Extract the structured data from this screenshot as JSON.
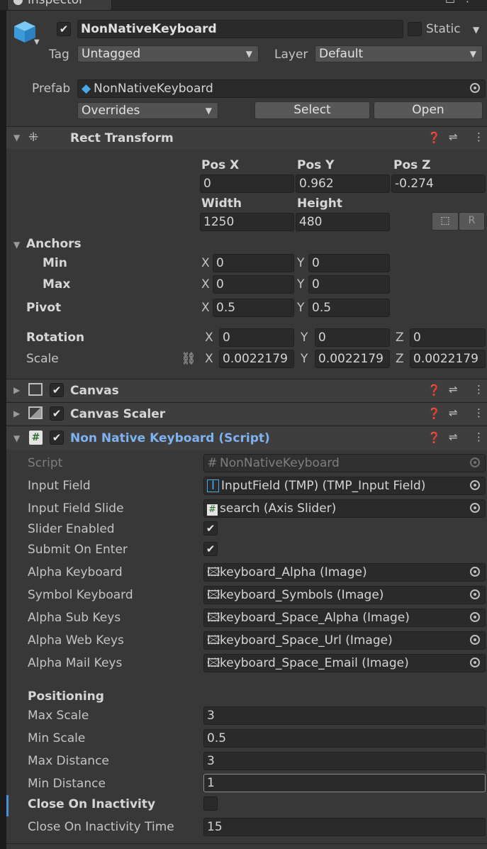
{
  "window": {
    "tab_title": "Inspector"
  },
  "object": {
    "active": true,
    "name": "NonNativeKeyboard",
    "static_label": "Static",
    "tag_label": "Tag",
    "tag_value": "Untagged",
    "layer_label": "Layer",
    "layer_value": "Default",
    "prefab_label": "Prefab",
    "prefab_value": "NonNativeKeyboard",
    "overrides_label": "Overrides",
    "select_label": "Select",
    "open_label": "Open"
  },
  "rect_transform": {
    "title": "Rect Transform",
    "pos_x_label": "Pos X",
    "pos_y_label": "Pos Y",
    "pos_z_label": "Pos Z",
    "pos_x": "0",
    "pos_y": "0.962",
    "pos_z": "-0.274",
    "width_label": "Width",
    "height_label": "Height",
    "width": "1250",
    "height": "480",
    "anchors_label": "Anchors",
    "min_label": "Min",
    "max_label": "Max",
    "min_x": "0",
    "min_y": "0",
    "max_x": "0",
    "max_y": "0",
    "pivot_label": "Pivot",
    "pivot_x": "0.5",
    "pivot_y": "0.5",
    "rotation_label": "Rotation",
    "rot_x": "0",
    "rot_y": "0",
    "rot_z": "0",
    "scale_label": "Scale",
    "scale_x": "0.0022179",
    "scale_y": "0.0022179",
    "scale_z": "0.0022179",
    "x": "X",
    "y": "Y",
    "z": "Z",
    "r_button": "R"
  },
  "components": {
    "canvas": "Canvas",
    "canvas_scaler": "Canvas Scaler",
    "script_title": "Non Native Keyboard (Script)"
  },
  "script": {
    "rows": [
      {
        "label": "Script",
        "value": "NonNativeKeyboard",
        "icon": "script-icon"
      },
      {
        "label": "Input Field",
        "value": "InputField (TMP) (TMP_Input Field)",
        "icon": "text-cursor-icon"
      },
      {
        "label": "Input Field Slide",
        "value": "search (Axis Slider)",
        "icon": "script-icon"
      },
      {
        "label": "Alpha Keyboard",
        "value": "keyboard_Alpha (Image)",
        "icon": "image-icon"
      },
      {
        "label": "Symbol Keyboard",
        "value": "keyboard_Symbols (Image)",
        "icon": "image-icon"
      },
      {
        "label": "Alpha Sub Keys",
        "value": "keyboard_Space_Alpha (Image)",
        "icon": "image-icon"
      },
      {
        "label": "Alpha Web Keys",
        "value": "keyboard_Space_Url (Image)",
        "icon": "image-icon"
      },
      {
        "label": "Alpha Mail Keys",
        "value": "keyboard_Space_Email (Image)",
        "icon": "image-icon"
      }
    ],
    "slider_enabled_label": "Slider Enabled",
    "slider_enabled": true,
    "submit_on_enter_label": "Submit On Enter",
    "submit_on_enter": true,
    "positioning_label": "Positioning",
    "max_scale_label": "Max Scale",
    "max_scale": "3",
    "min_scale_label": "Min Scale",
    "min_scale": "0.5",
    "max_distance_label": "Max Distance",
    "max_distance": "3",
    "min_distance_label": "Min Distance",
    "min_distance": "1",
    "close_on_inactivity_label": "Close On Inactivity",
    "close_on_inactivity": false,
    "close_time_label": "Close On Inactivity Time",
    "close_time": "15"
  },
  "colors": {
    "background": "#383838",
    "field": "#2a2a2a",
    "header": "#3e3e3e",
    "accent_blue": "#7fb2f0",
    "cube_blue": "#4aa8e8"
  }
}
